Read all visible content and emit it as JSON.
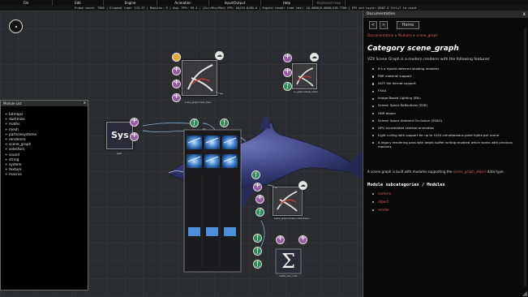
{
  "menubar": {
    "items": [
      "File",
      "Edit",
      "Engine",
      "Animation",
      "Input/Output",
      "Help",
      "Keyboard map"
    ]
  },
  "status": {
    "text": "Frame count: 7965 | Elapsed time: 115.37 | Modules: 9 | Avg. FPS: 59.4 | [Cur/Min/Max] FPS: 60/59.8/60.0 | Engine render time (ms): 16.0000/0.0000/416.7700 | FPS min vsync: 8507.3 Ctrl+T to reset"
  },
  "module_list": {
    "title": "Module List",
    "close": "x",
    "items": [
      "+ bitmaps",
      "+ dummies",
      "+ maths",
      "+ mesh",
      "+ particlesystems",
      "+ renderers",
      "+ scene_graph",
      "+ selectors",
      "+ sound",
      "+ string",
      "+ system",
      "+ texture",
      "+ macros"
    ]
  },
  "workspace": {
    "node_labels": {
      "sys": "sys0",
      "mesh_top": "scene_graph.mesh_trans",
      "mesh_right": "sc_graph.simple_mesh",
      "mesh_lower": "scene_graph.simple_mesh.scene..",
      "tex_grid": "texture.config",
      "sum": "maths_sum_node"
    },
    "sys_label": "Sys",
    "tex_grid_caption": "SC"
  },
  "documentation": {
    "title": "Documentation",
    "close": "x",
    "nav": {
      "back": "<",
      "forward": ">",
      "home": "Home"
    },
    "breadcrumb": {
      "a": "Documentation",
      "sep": " » ",
      "b": "Modules",
      "c": "scene_graph"
    },
    "heading": "Category scene_graph",
    "intro": "VZX Scene Graph is a modern renderer with the following features:",
    "features": [
      "It's a hybrid deferred shading renderer",
      "PBR material support",
      "GLTF file format support",
      "FXAA",
      "Image Based Lighting (IBL)",
      "Screen Space Reflections (SSR)",
      "HDR bloom",
      "Screen Space Ambient Occlusion (SSAO)",
      "GPU accelerated skeletal animation",
      "Light culling with support for up to 1024 simultaneous point lights per scene",
      "A legacy rendering pass with depth buffer writing enabled which works with previous modules"
    ],
    "para_pre": "A scene graph is built with modules supporting the ",
    "para_link": "scene_graph_object",
    "para_post": " data type.",
    "subheading": "Module subcategories / Modules",
    "subcats": [
      "camera",
      "object",
      "render"
    ]
  },
  "colors": {
    "link": "#e05a5a",
    "pin_add": "#9a5aa3",
    "pin_folder": "#e0a93a",
    "pin_tt": "#2e8b57",
    "dolphin": "#343b75"
  },
  "icons": [
    "home-icon",
    "plus-icon",
    "folder-icon",
    "cloud-icon",
    "function-icon",
    "sigma-icon",
    "close-icon"
  ]
}
